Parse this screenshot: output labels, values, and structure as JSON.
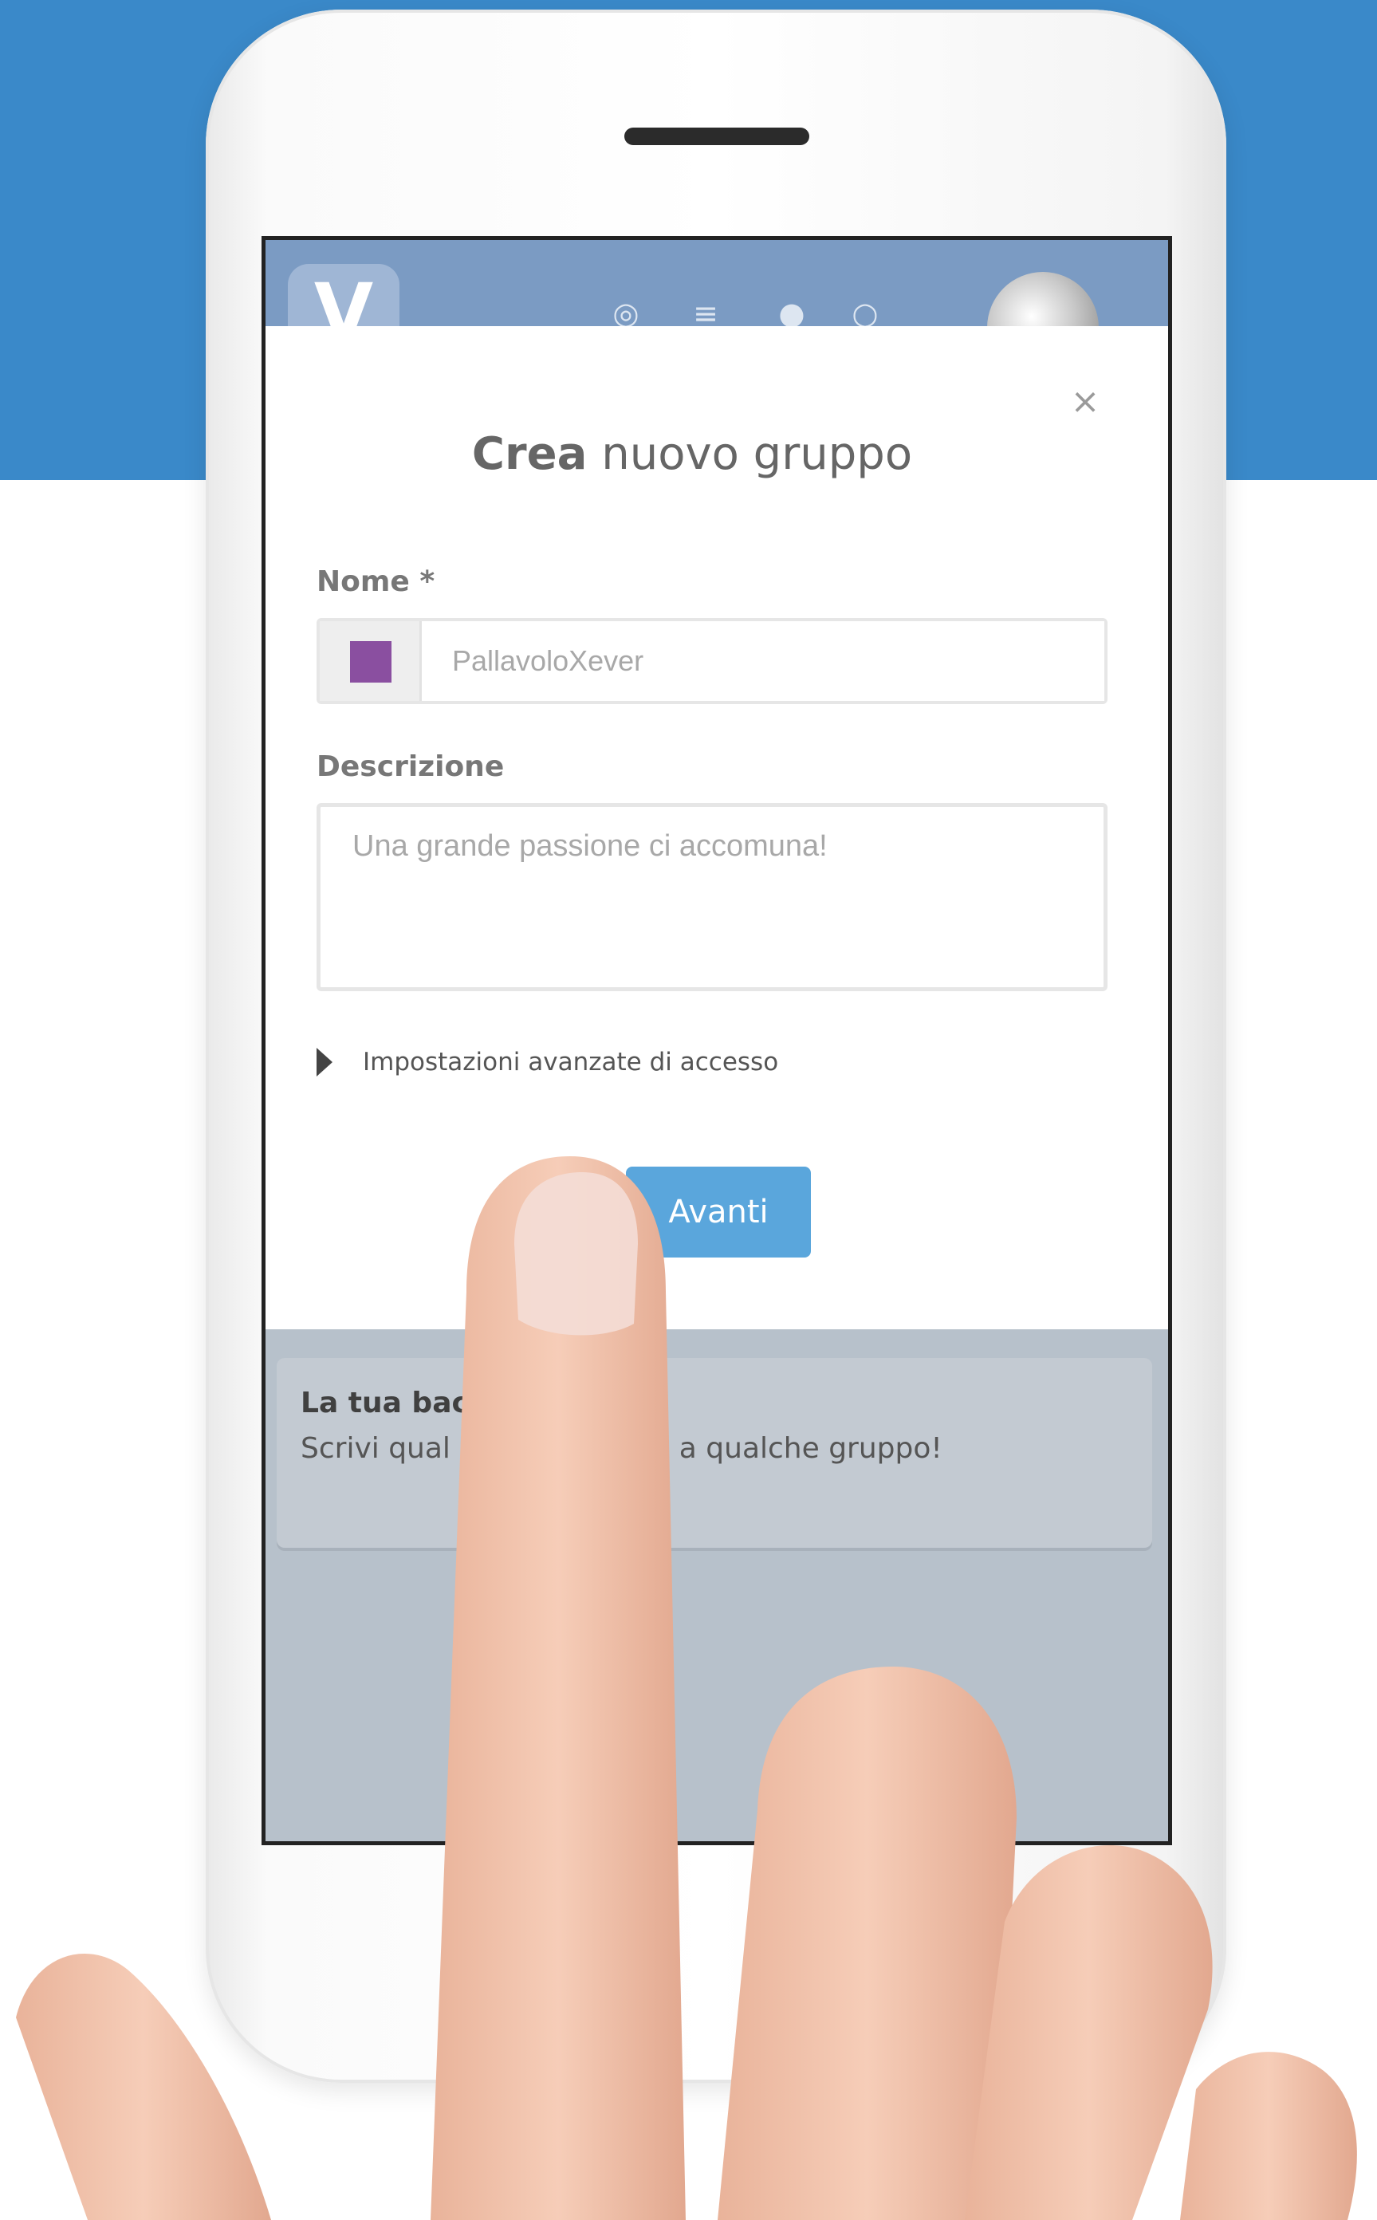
{
  "app": {
    "logo_letter": "V",
    "nav_icons": [
      "pin-icon",
      "menu-icon",
      "bell-icon",
      "user-icon"
    ]
  },
  "modal": {
    "title_bold": "Crea",
    "title_rest": " nuovo gruppo",
    "close_label": "×",
    "name_label": "Nome *",
    "name_placeholder": "PallavoloXever",
    "group_color": "#8a4fa0",
    "description_label": "Descrizione",
    "description_placeholder": "Una grande passione ci accomuna!",
    "advanced_toggle_label": "Impostazioni avanzate di accesso",
    "next_button_label": "Avanti"
  },
  "feed_card": {
    "title": "La tua bac",
    "text": "Scrivi qual                     rofilo o unisciti a qualche gruppo!"
  },
  "colors": {
    "background_band": "#3a89c9",
    "primary_button": "#5aa6dc"
  }
}
